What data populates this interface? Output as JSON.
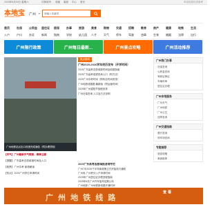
{
  "topbar": {
    "date": "2025年8月30日 星期六",
    "links": [
      "切换城市",
      "收藏",
      "客服",
      "中心",
      "首页"
    ],
    "notice": "本站信息仅供参考"
  },
  "header": {
    "logo": "本地宝",
    "logo_sub": "Bendibao.com",
    "city": "广州",
    "search_placeholder": "请输入关键词",
    "accent": "#ff6600"
  },
  "nav": {
    "row1": [
      "首页",
      "社保",
      "公积金",
      "居住证",
      "医保",
      "办事",
      "旅游",
      "美食",
      "购物",
      "交通",
      "招聘",
      "教育",
      "房产",
      "健康",
      "地铁",
      "生活"
    ],
    "row2": [
      "入户",
      "户口",
      "办证",
      "新闻",
      "指南",
      "学校",
      "幼儿园",
      "人才",
      "天气",
      "停车",
      "驾驶",
      "违章",
      "生育",
      "婚姻",
      "法律",
      "出行"
    ]
  },
  "banners": [
    "广州限行政策",
    "广州每日最新...",
    "广州景点攻略",
    "广州活动推荐"
  ],
  "carousel": {
    "caption": "广州地铁站点出口改造完成通告（附办理须知）"
  },
  "headline": {
    "tag": "焦点新闻",
    "title": "广州2025-2026学年校历发布（开学时间）",
    "items": [
      "2025广东高考志愿填报时间及填报指南",
      "2025广东高考成绩查询入口（附方法）",
      "2025广州中考时间（附科目时间安排）",
      "广州地铁线路图 最新版（附运营时间）",
      "2025年广州重阳节放假安排",
      "广州社保查询 入口及方法说明"
    ]
  },
  "mid": {
    "title": "2025广东高考志愿填报咨询专栏",
    "items": [
      "广州7月2025下半年新政策正式开始执行通知",
      "广州电 广州积分入户申请时间",
      "2025年广州居住证办理流程指南",
      "2025年8月广州汽车摇号结果公布",
      "广州地铁 广州地铁新线路开通时间"
    ]
  },
  "left_list": [
    "【天气】广州最新天气预报，雨季注意",
    "【提醒】广东高考志愿填报时间及入口",
    "【政策】广州中考 新政解读",
    "【热点】2025广州学位申请时间"
  ],
  "side": {
    "box1": {
      "title": "广州热门办事",
      "items": [
        "社保查询",
        "公积金查询",
        "驾驶证换证",
        "车辆年审",
        "居住证办理"
      ]
    },
    "box2": {
      "title": "广州本地服务",
      "items": [
        "广州天气",
        "广州地铁",
        "广州公交",
        "违章查询"
      ]
    },
    "box3": {
      "title": "广州交通指南",
      "items": [
        "限行查询",
        "停车场查询"
      ]
    },
    "box4": {
      "title": "专题推荐",
      "items": [
        "旅游攻略",
        "美食推荐"
      ]
    }
  },
  "bottom_banner": {
    "text": "广 州 地 铁 线 路",
    "tag": "查看"
  }
}
